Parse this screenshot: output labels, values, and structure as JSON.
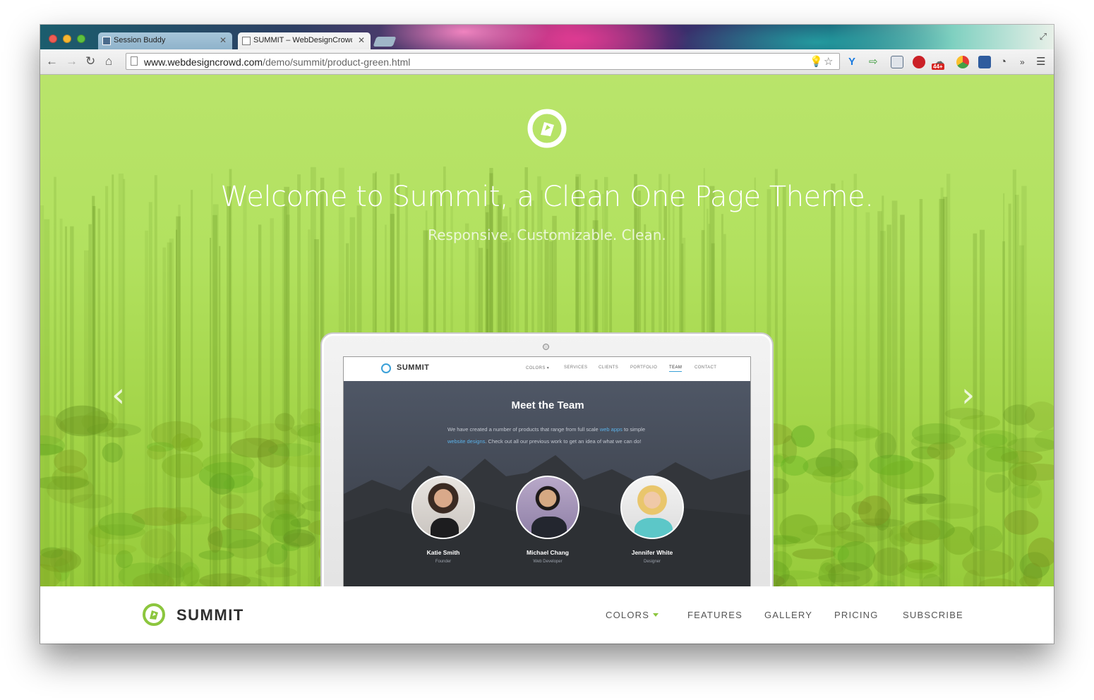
{
  "browser": {
    "tabs": [
      {
        "label": "Session Buddy",
        "active": false
      },
      {
        "label": "SUMMIT – WebDesignCrowd",
        "active": true
      }
    ],
    "url_host": "www.webdesigncrowd.com",
    "url_path": "/demo/summit/product-green.html",
    "extension_badge": "44+"
  },
  "hero": {
    "title": "Welcome to Summit, a Clean One Page Theme.",
    "subtitle": "Responsive. Customizable. Clean.",
    "prev_arrow": "‹",
    "next_arrow": "›"
  },
  "screenshot_preview": {
    "brand": "SUMMIT",
    "menu": [
      "COLORS ▾",
      "SERVICES",
      "CLIENTS",
      "PORTFOLIO",
      "TEAM",
      "CONTACT"
    ],
    "active_menu": "TEAM",
    "section_title": "Meet the Team",
    "desc_part1": "We have created a number of products that range from full scale ",
    "desc_link1": "web apps",
    "desc_part2": " to simple ",
    "desc_link2": "website designs",
    "desc_part3": ". Check out all our previous work to get an idea of what we can do!",
    "team": [
      {
        "name": "Katie Smith",
        "role": "Founder"
      },
      {
        "name": "Michael Chang",
        "role": "Web Developer"
      },
      {
        "name": "Jennifer White",
        "role": "Designer"
      }
    ]
  },
  "navbar": {
    "brand": "SUMMIT",
    "items": [
      "COLORS",
      "FEATURES",
      "GALLERY",
      "PRICING",
      "SUBSCRIBE"
    ]
  },
  "colors": {
    "accent_green": "#8cc63e",
    "hero_green": "#b2e15f",
    "link_blue": "#5ab1e8"
  }
}
